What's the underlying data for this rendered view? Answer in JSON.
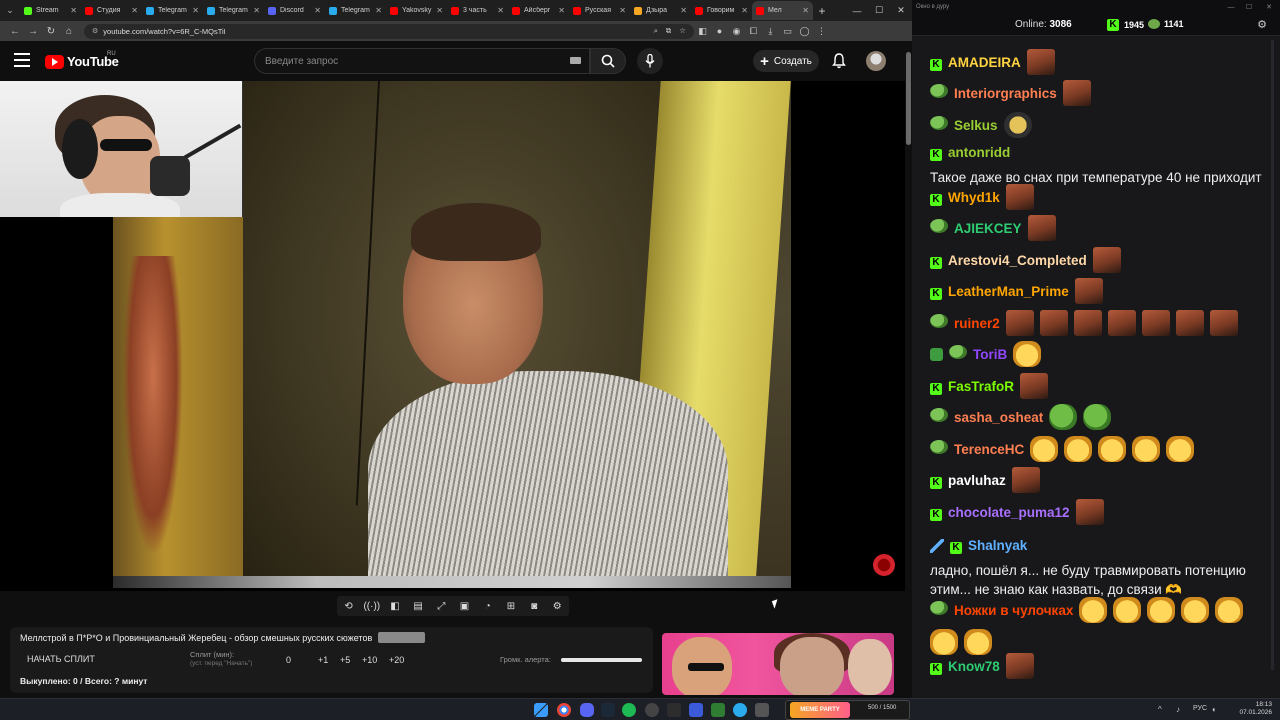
{
  "browser": {
    "tabs": [
      {
        "label": "Stream",
        "color": "#53fc18"
      },
      {
        "label": "Студия",
        "color": "#ff0000"
      },
      {
        "label": "Telegram",
        "color": "#2aabee"
      },
      {
        "label": "Telegram",
        "color": "#2aabee"
      },
      {
        "label": "Discord",
        "color": "#5865f2"
      },
      {
        "label": "Telegram",
        "color": "#2aabee"
      },
      {
        "label": "Yakovsky",
        "color": "#ff0000"
      },
      {
        "label": "3 часть",
        "color": "#ff0000"
      },
      {
        "label": "Айсберг",
        "color": "#ff0000"
      },
      {
        "label": "Русская",
        "color": "#ff0000"
      },
      {
        "label": "Дзыра",
        "color": "#f5a623"
      },
      {
        "label": "Говорим",
        "color": "#ff0000"
      },
      {
        "label": "Мел",
        "color": "#ff0000"
      }
    ],
    "url": "youtube.com/watch?v=6R_C-MQsTiI"
  },
  "youtube": {
    "logo_text": "YouTube",
    "region": "RU",
    "search_placeholder": "Введите запрос",
    "create_label": "Создать"
  },
  "widget": {
    "title": "Меллстрой в П*Р*О и Провинциальный Жеребец - обзор смешных русских сюжетов",
    "title_tag": "",
    "start_split": "НАЧАТЬ СПЛИТ",
    "split_label": "Сплит (мин):",
    "split_sub": "(уст. перед \"Начать\")",
    "split_value": "0",
    "increments": [
      "+1",
      "+5",
      "+10",
      "+20"
    ],
    "alert_label": "Громк. алерта:",
    "alert_volume_percent": 100,
    "bought": "Выкуплено: 0 / Всего: ? минут"
  },
  "chat": {
    "window_title": "Окно в дуру",
    "online_label": "Online:",
    "online_count": "3086",
    "kick_count": "1945",
    "twitch_count": "1141",
    "messages": [
      {
        "platform": "kick",
        "user": "AMADEIRA",
        "color": "#ffd23f",
        "text": "",
        "emotes": [
          "face"
        ]
      },
      {
        "platform": "twitch",
        "user": "Interiorgraphics",
        "color": "#ff7f50",
        "text": "",
        "emotes": [
          "face"
        ]
      },
      {
        "platform": "twitch",
        "user": "Selkus",
        "color": "#9acd32",
        "text": "",
        "emotes": [
          "cat"
        ]
      },
      {
        "platform": "kick",
        "user": "antonridd",
        "color": "#9acd32",
        "text": "Такое даже во снах при температуре 40 не приходит",
        "emotes": []
      },
      {
        "platform": "kick",
        "user": "Whyd1k",
        "color": "#ffa500",
        "text": "",
        "emotes": [
          "face"
        ]
      },
      {
        "platform": "twitch",
        "user": "AJIEKCEY",
        "color": "#2ecc71",
        "text": "",
        "emotes": [
          "face"
        ]
      },
      {
        "platform": "kick",
        "user": "Arestovi4_Completed",
        "color": "#ffd8a8",
        "text": "",
        "emotes": [
          "face"
        ]
      },
      {
        "platform": "kick",
        "user": "LeatherMan_Prime",
        "color": "#ffa500",
        "text": "",
        "emotes": [
          "face"
        ]
      },
      {
        "platform": "twitch",
        "user": "ruiner2",
        "color": "#ff4500",
        "text": "",
        "emotes": [
          "face",
          "face",
          "face",
          "face",
          "face",
          "face",
          "face"
        ]
      },
      {
        "platform": "twitch",
        "user": "ToriB",
        "color": "#9146ff",
        "text": "",
        "emotes": [
          "laugh"
        ]
      },
      {
        "platform": "kick",
        "user": "FasTrafoR",
        "color": "#7cfc00",
        "text": "",
        "emotes": [
          "face"
        ]
      },
      {
        "platform": "twitch",
        "user": "sasha_osheat",
        "color": "#ff7f50",
        "text": "",
        "emotes": [
          "pepe",
          "pepe"
        ]
      },
      {
        "platform": "twitch",
        "user": "TerenceHC",
        "color": "#ff7f50",
        "text": "",
        "emotes": [
          "laugh",
          "laugh",
          "laugh",
          "laugh",
          "laugh"
        ]
      },
      {
        "platform": "kick",
        "user": "pavluhaz",
        "color": "#ffffff",
        "text": "",
        "emotes": [
          "face"
        ]
      },
      {
        "platform": "kick",
        "user": "chocolate_puma12",
        "color": "#a970ff",
        "text": "",
        "emotes": [
          "face"
        ]
      },
      {
        "platform": "kick",
        "user": "Shalnyak",
        "color": "#5fb0ff",
        "text": "ладно, пошёл я... не буду травмировать потенцию этим... не знаю как назвать, до связи 🫶",
        "emotes": []
      },
      {
        "platform": "twitch",
        "user": "Ножки в чулочках",
        "color": "#ff4500",
        "text": "",
        "emotes": [
          "laugh",
          "laugh",
          "laugh",
          "laugh",
          "laugh",
          "laugh",
          "laugh"
        ]
      },
      {
        "platform": "kick",
        "user": "Know78",
        "color": "#2ecc71",
        "text": "",
        "emotes": [
          "face"
        ]
      }
    ]
  },
  "taskbar": {
    "overlay_brand": "MEME PARTY",
    "overlay_counter": "500 / 1500",
    "lang": "РУС",
    "time": "18:13",
    "date": "07.01.2026"
  },
  "colors": {
    "kick_green": "#53fc18",
    "youtube_red": "#ff0000",
    "chat_bg": "#18181b"
  }
}
